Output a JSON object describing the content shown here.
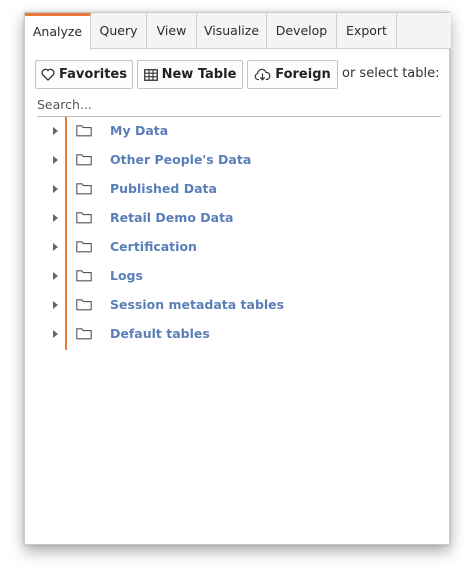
{
  "tabs": [
    {
      "label": "Analyze",
      "active": true
    },
    {
      "label": "Query",
      "active": false
    },
    {
      "label": "View",
      "active": false
    },
    {
      "label": "Visualize",
      "active": false
    },
    {
      "label": "Develop",
      "active": false
    },
    {
      "label": "Export",
      "active": false
    }
  ],
  "toolbar": {
    "favorites_label": "Favorites",
    "favorites_icon": "heart-icon",
    "new_table_label": "New Table",
    "new_table_icon": "table-icon",
    "foreign_label": "Foreign",
    "foreign_icon": "cloud-download-icon",
    "select_text": "or select table:"
  },
  "search": {
    "placeholder": "Search...",
    "value": ""
  },
  "tree": {
    "items": [
      {
        "label": "My Data",
        "icon": "folder-icon"
      },
      {
        "label": "Other People's Data",
        "icon": "folder-icon"
      },
      {
        "label": "Published Data",
        "icon": "folder-icon"
      },
      {
        "label": "Retail Demo Data",
        "icon": "folder-icon"
      },
      {
        "label": "Certification",
        "icon": "folder-icon"
      },
      {
        "label": "Logs",
        "icon": "folder-icon"
      },
      {
        "label": "Session metadata tables",
        "icon": "folder-icon"
      },
      {
        "label": "Default tables",
        "icon": "folder-icon"
      }
    ]
  },
  "colors": {
    "accent": "#e8783b",
    "link": "#5a7fb8"
  }
}
